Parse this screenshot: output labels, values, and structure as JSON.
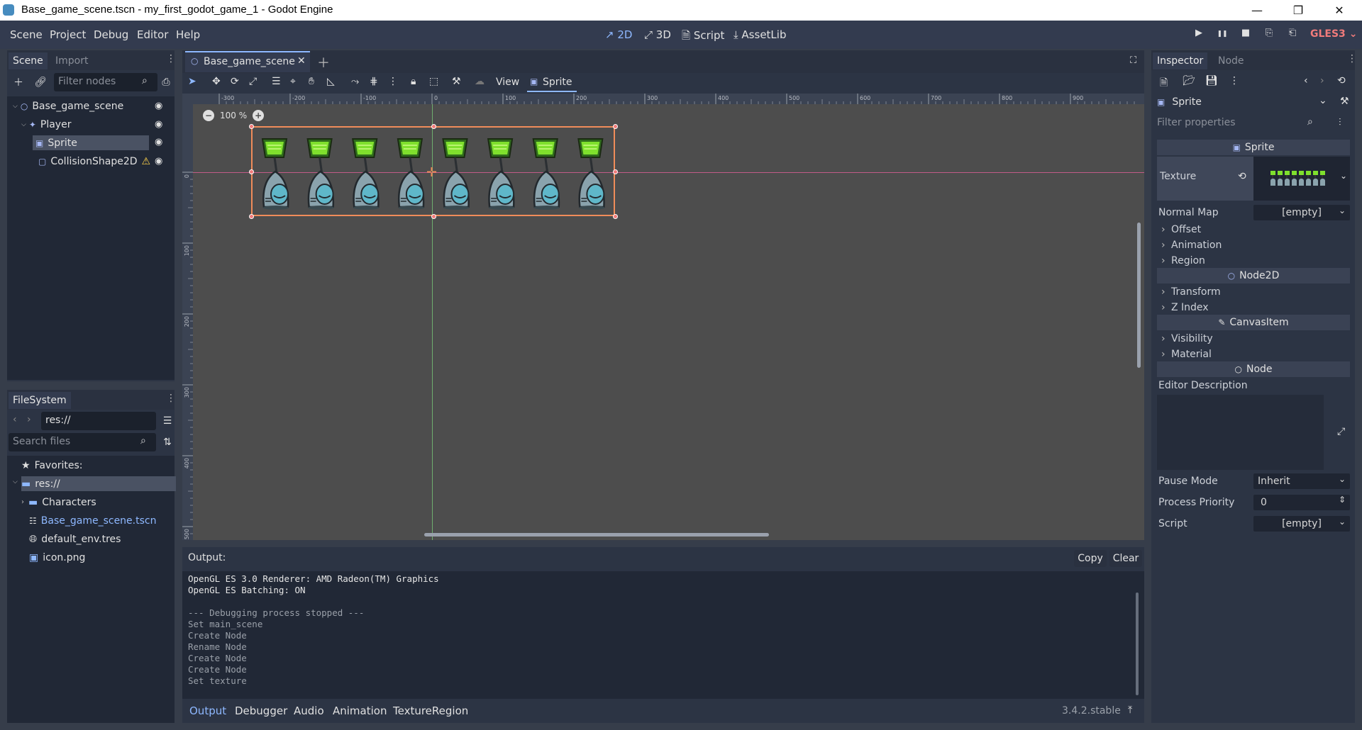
{
  "window": {
    "title": "Base_game_scene.tscn - my_first_godot_game_1 - Godot Engine",
    "minimize": "—",
    "maximize": "❐",
    "close": "✕"
  },
  "menubar": {
    "menus": [
      "Scene",
      "Project",
      "Debug",
      "Editor",
      "Help"
    ],
    "modes": [
      {
        "label": "2D",
        "icon": "2d-icon"
      },
      {
        "label": "3D",
        "icon": "3d-icon"
      },
      {
        "label": "Script",
        "icon": "script-icon"
      },
      {
        "label": "AssetLib",
        "icon": "assetlib-icon"
      }
    ],
    "renderer": "GLES3",
    "play_icons": [
      "▶",
      "❚❚",
      "■",
      "⎘",
      "⎗"
    ]
  },
  "scene_dock": {
    "tabs": [
      "Scene",
      "Import"
    ],
    "filter_placeholder": "Filter nodes",
    "nodes": [
      {
        "label": "Base_game_scene",
        "icon": "node2d-icon"
      },
      {
        "label": "Player",
        "icon": "kinematic-body-icon"
      },
      {
        "label": "Sprite",
        "icon": "sprite-icon"
      },
      {
        "label": "CollisionShape2D",
        "icon": "collision-shape-icon",
        "warning": "⚠"
      }
    ]
  },
  "filesystem_dock": {
    "tab": "FileSystem",
    "path": "res://",
    "search_placeholder": "Search files",
    "favorites": "Favorites:",
    "items": [
      {
        "label": "res://"
      },
      {
        "label": "Characters"
      },
      {
        "label": "Base_game_scene.tscn"
      },
      {
        "label": "default_env.tres"
      },
      {
        "label": "icon.png"
      }
    ]
  },
  "editor": {
    "scene_tab": "Base_game_scene",
    "toolbar": {
      "view": "View",
      "sprite_menu": "Sprite"
    },
    "zoom": "100 %",
    "ruler_h": [
      "-300",
      "-200",
      "-100",
      "0",
      "100",
      "200",
      "300",
      "400",
      "500",
      "600",
      "700",
      "800",
      "900"
    ],
    "ruler_v": [
      "0",
      "100",
      "200",
      "300",
      "400",
      "500"
    ],
    "frame_count": 8
  },
  "output": {
    "label": "Output:",
    "copy": "Copy",
    "clear": "Clear",
    "lines": [
      {
        "text": "OpenGL ES 3.0 Renderer: AMD Radeon(TM) Graphics"
      },
      {
        "text": "OpenGL ES Batching: ON"
      },
      {
        "text": ""
      },
      {
        "text": "--- Debugging process stopped ---"
      },
      {
        "text": "Set main_scene"
      },
      {
        "text": "Create Node"
      },
      {
        "text": "Rename Node"
      },
      {
        "text": "Create Node"
      },
      {
        "text": "Create Node"
      },
      {
        "text": "Set texture"
      }
    ],
    "bottom_tabs": [
      "Output",
      "Debugger",
      "Audio",
      "Animation",
      "TextureRegion"
    ],
    "version": "3.4.2.stable"
  },
  "inspector": {
    "tabs": [
      "Inspector",
      "Node"
    ],
    "object": "Sprite",
    "filter_placeholder": "Filter properties",
    "sections": {
      "sprite": "Sprite",
      "texture_label": "Texture",
      "normal_map_label": "Normal Map",
      "normal_map_value": "[empty]",
      "groups1": [
        "Offset",
        "Animation",
        "Region"
      ],
      "node2d": "Node2D",
      "groups2": [
        "Transform",
        "Z Index"
      ],
      "canvasitem": "CanvasItem",
      "groups3": [
        "Visibility",
        "Material"
      ],
      "node": "Node",
      "editor_description": "Editor Description",
      "pause_mode_label": "Pause Mode",
      "pause_mode_value": "Inherit",
      "process_priority_label": "Process Priority",
      "process_priority_value": "0",
      "script_label": "Script",
      "script_value": "[empty]"
    }
  },
  "colors": {
    "accent": "#8eb8ff",
    "selection": "#f08c5a",
    "renderer": "#f17b7b",
    "warning": "#ffd24a",
    "link": "#8eb8ff"
  }
}
